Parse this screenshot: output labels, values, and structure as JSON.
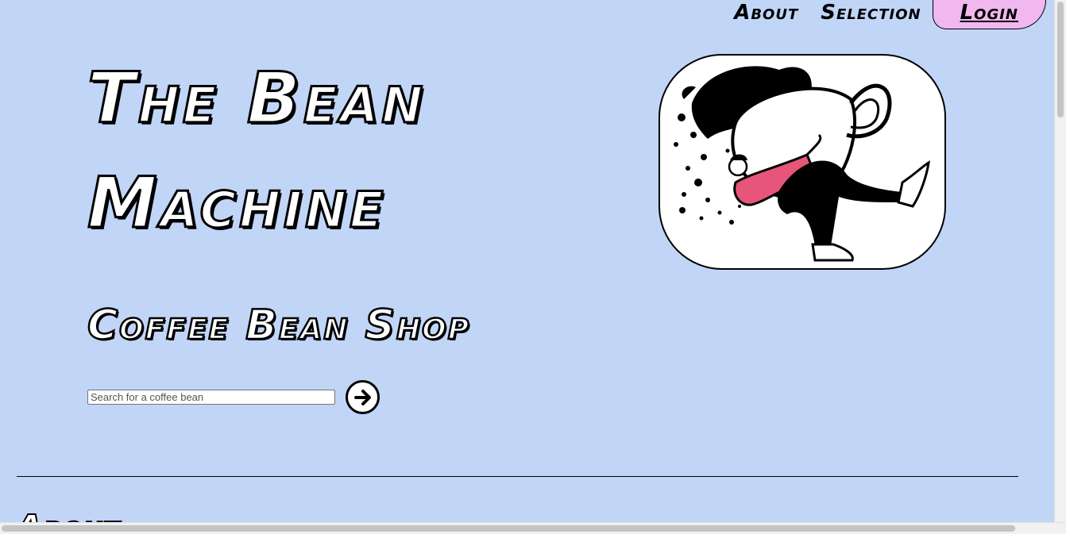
{
  "nav": {
    "about": "About",
    "selection": "Selection",
    "login": "Login"
  },
  "hero": {
    "title": "The Bean Machine",
    "subtitle": "Coffee Bean Shop"
  },
  "search": {
    "placeholder": "Search for a coffee bean",
    "value": ""
  },
  "next_section": {
    "heading": "About"
  },
  "icons": {
    "go": "arrow-right-circle-icon",
    "illustration": "coffee-cup-person-illustration"
  },
  "colors": {
    "background": "#c1d5f7",
    "login_bg": "#f0b8ef",
    "accent_pink": "#e8557a"
  }
}
